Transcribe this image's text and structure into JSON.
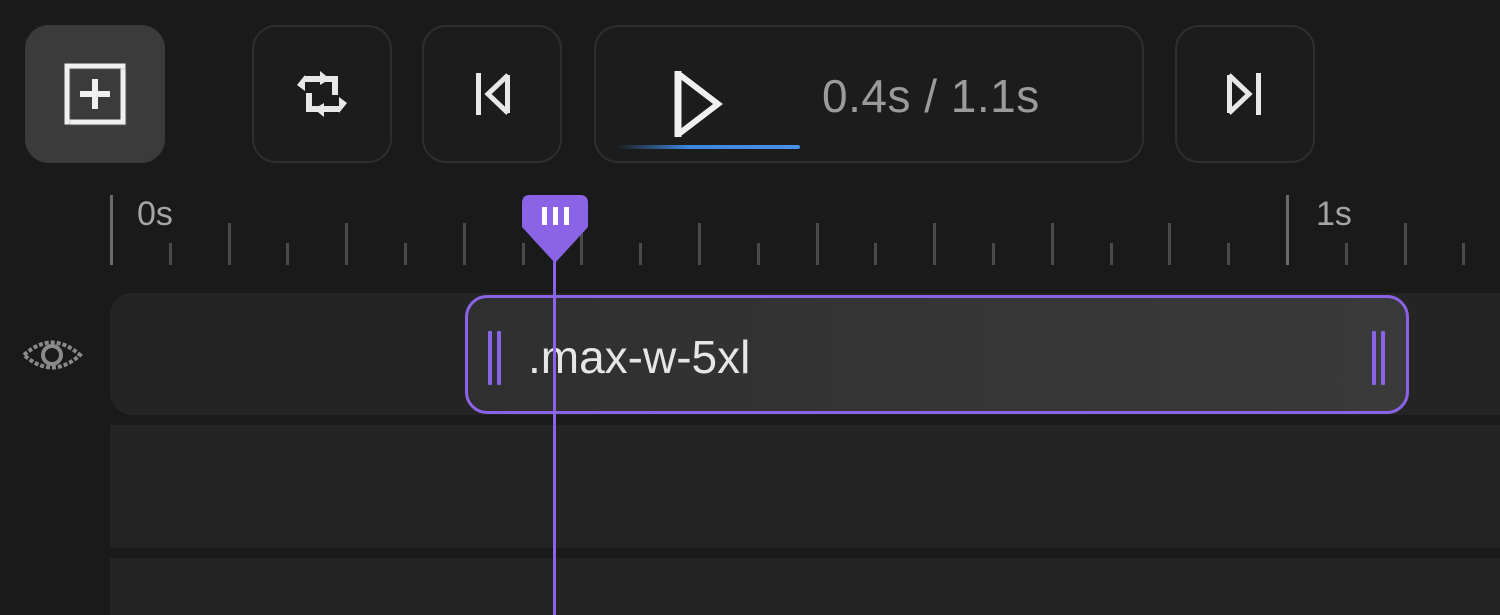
{
  "toolbar": {
    "add_button": {
      "icon": "add-square-icon"
    },
    "loop_button": {
      "icon": "loop-icon"
    },
    "prev_button": {
      "icon": "skip-previous-icon"
    },
    "play_button": {
      "icon": "play-icon",
      "time_label": "0.4s / 1.1s",
      "progress": 0.36
    },
    "next_button": {
      "icon": "skip-next-icon"
    }
  },
  "ruler": {
    "labels": [
      {
        "text": "0s"
      },
      {
        "text": "1s"
      }
    ]
  },
  "tracks": [
    {
      "visibility_icon": "eye-icon",
      "clip": {
        "label": ".max-w-5xl"
      }
    },
    {},
    {}
  ],
  "playhead": {
    "time": "0.4s"
  },
  "colors": {
    "accent": "#8b63e6",
    "progress": "#4a90e6",
    "background": "#1a1a1a",
    "track": "#242424"
  }
}
